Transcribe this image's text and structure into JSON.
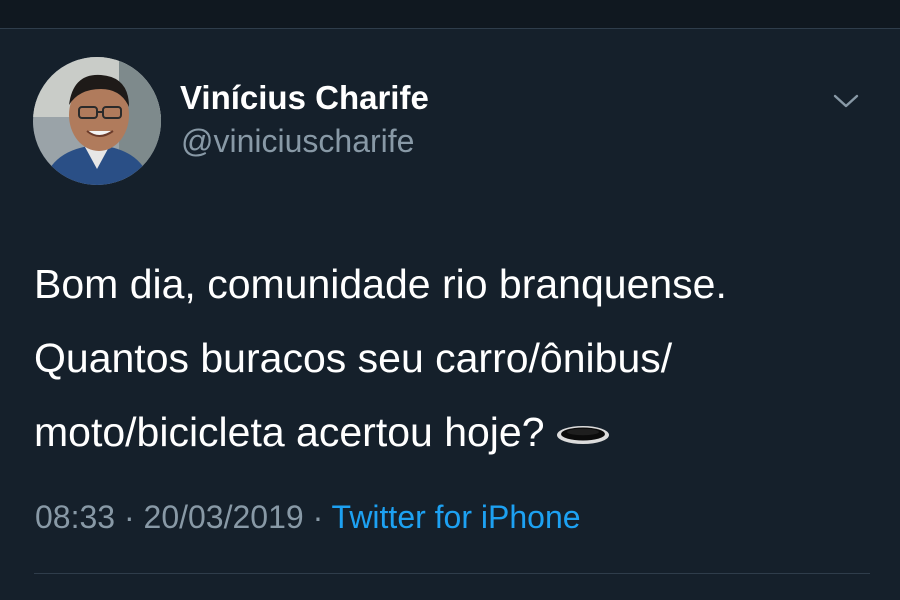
{
  "user": {
    "display_name": "Vinícius Charife",
    "handle": "@viniciuscharife"
  },
  "tweet": {
    "lines": [
      "Bom dia, comunidade rio branquense.",
      "Quantos buracos seu carro/ônibus/",
      "moto/bicicleta acertou hoje?"
    ],
    "emoji": "hole-emoji"
  },
  "meta": {
    "time": "08:33",
    "separator": " · ",
    "date": "20/03/2019",
    "source": "Twitter for iPhone"
  },
  "icons": {
    "menu": "chevron-down-icon"
  },
  "colors": {
    "background": "#15202b",
    "text": "#ffffff",
    "secondary": "#8899a6",
    "link": "#1da1f2"
  }
}
